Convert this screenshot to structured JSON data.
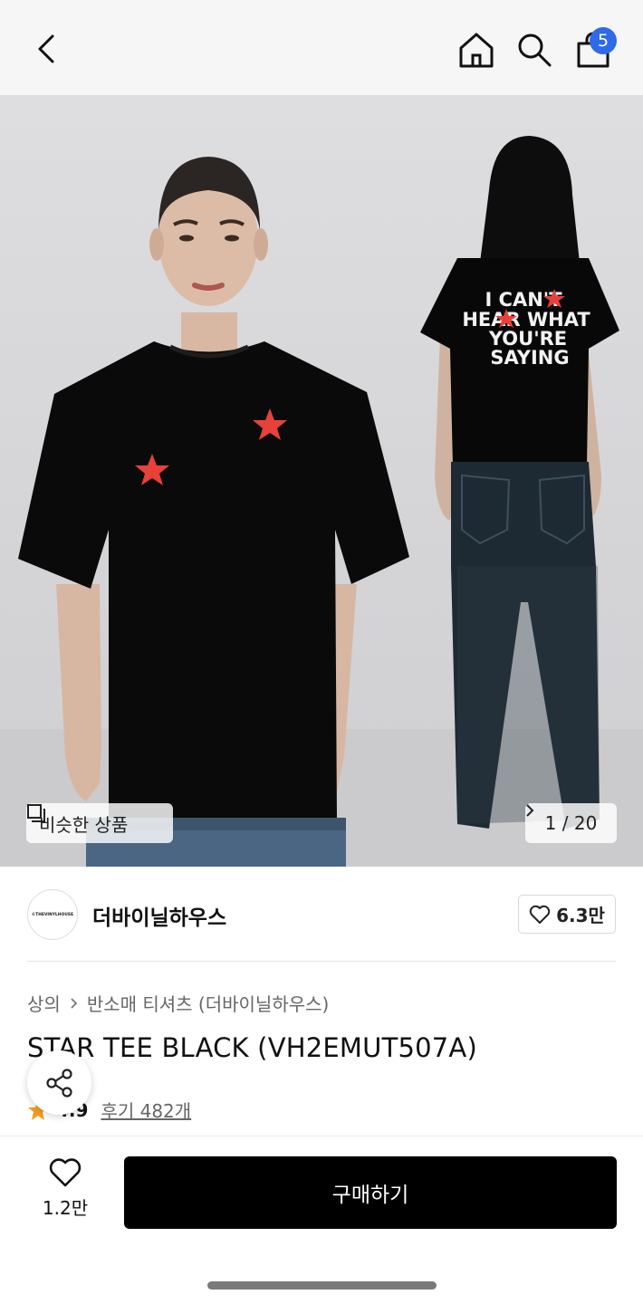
{
  "header": {
    "back_icon": "chevron-left-icon",
    "home_icon": "home-icon",
    "search_icon": "search-icon",
    "cart_icon": "shopping-bag-icon",
    "cart_count": "5",
    "badge_color": "#2f6ae8"
  },
  "hero": {
    "similar_label": "비슷한 상품",
    "counter_label": "1 / 20",
    "back_print_text": [
      "I CAN'T",
      "HEAR WHAT",
      "YOU'RE",
      "SAYING"
    ]
  },
  "brand": {
    "logo_text": "©THEVINYLHOUSE",
    "name": "더바이닐하우스",
    "likes": "6.3만"
  },
  "product": {
    "breadcrumb": [
      "상의",
      "반소매 티셔츠 (더바이닐하우스)"
    ],
    "title": "STAR TEE BLACK (VH2EMUT507A)",
    "rating": "4.9",
    "reviews": "후기 482개"
  },
  "bottom_bar": {
    "wish_count": "1.2만",
    "buy_label": "구매하기"
  },
  "colors": {
    "accent": "#000000",
    "star": "#f39c1f",
    "print_star": "#e8413a"
  }
}
